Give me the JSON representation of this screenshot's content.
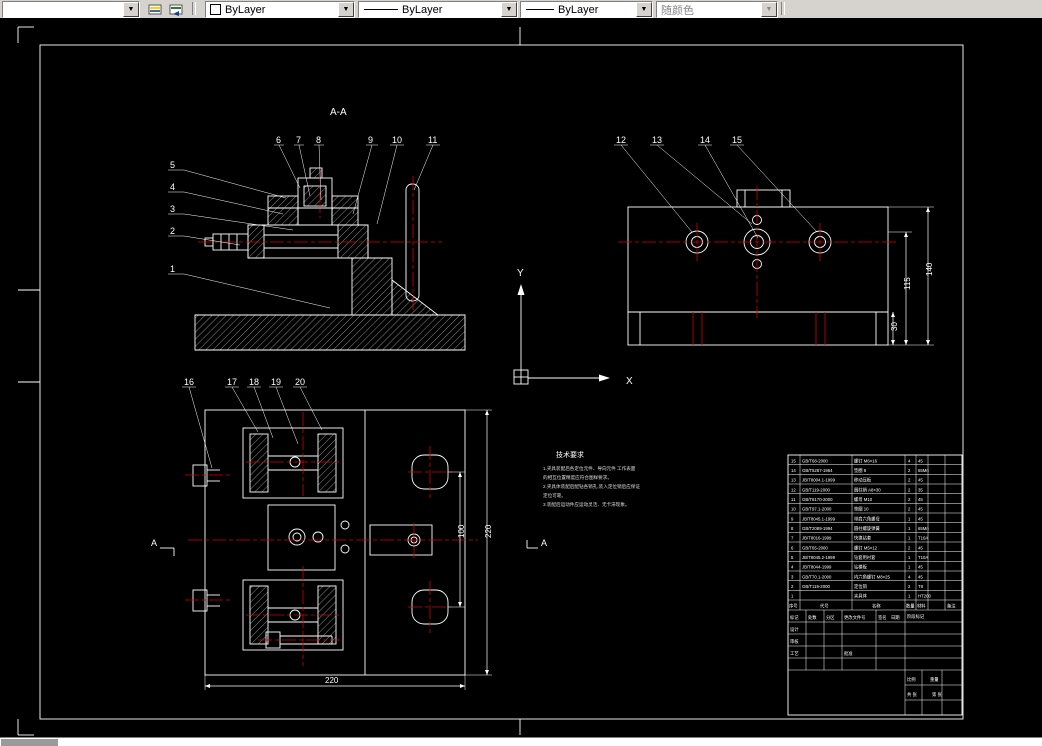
{
  "toolbar": {
    "color_combo": "ByLayer",
    "linetype_combo": "ByLayer",
    "lineweight_combo": "ByLayer",
    "plotstyle_combo": "随颜色"
  },
  "drawing": {
    "section_title": "A-A",
    "axis_x": "X",
    "axis_y": "Y",
    "section_mark_left": "A",
    "section_mark_right": "A",
    "callouts": {
      "c1": "1",
      "c2": "2",
      "c3": "3",
      "c4": "4",
      "c5": "5",
      "c6": "6",
      "c7": "7",
      "c8": "8",
      "c9": "9",
      "c10": "10",
      "c11": "11",
      "c12": "12",
      "c13": "13",
      "c14": "14",
      "c15": "15",
      "c16": "16",
      "c17": "17",
      "c18": "18",
      "c19": "19",
      "c20": "20"
    },
    "dimensions": {
      "d115": "115",
      "d140": "140",
      "d30": "30",
      "d100": "100",
      "d220v": "220",
      "d220h": "220"
    },
    "notes_title": "技术要求",
    "notes": [
      "1.夹具装配后各定位元件、导向元件 工作表面",
      "  的相互位置精度应符合图样要求。",
      "2.夹具体装配后配钻各销孔,装入定位销后应保证",
      "  定位可靠。",
      "3.装配后运动件应运动灵活、无卡滞现象。"
    ],
    "parts_list": {
      "rows": [
        {
          "no": "15",
          "code": "GB/T68-2000",
          "name": "螺钉 M6×16",
          "qty": "4",
          "mat": "45"
        },
        {
          "no": "14",
          "code": "GB/T5287-1964",
          "name": "垫圈 8",
          "qty": "2",
          "mat": "65Mn"
        },
        {
          "no": "13",
          "code": "JB/T8004.1-1999",
          "name": "移动压板",
          "qty": "2",
          "mat": "45"
        },
        {
          "no": "12",
          "code": "GB/T119-2000",
          "name": "圆柱销 A8×30",
          "qty": "2",
          "mat": "35"
        },
        {
          "no": "11",
          "code": "GB/T6170-2000",
          "name": "螺母 M10",
          "qty": "2",
          "mat": "45"
        },
        {
          "no": "10",
          "code": "GB/T97.1-2000",
          "name": "垫圈 10",
          "qty": "2",
          "mat": "45"
        },
        {
          "no": "9",
          "code": "JB/T8045.1-1999",
          "name": "带肩六角螺母",
          "qty": "1",
          "mat": "45"
        },
        {
          "no": "8",
          "code": "GB/T2089-1994",
          "name": "圆柱螺旋弹簧",
          "qty": "1",
          "mat": "65Mn"
        },
        {
          "no": "7",
          "code": "JB/T8016-1999",
          "name": "快换钻套",
          "qty": "1",
          "mat": "T10A"
        },
        {
          "no": "6",
          "code": "GB/T65-2000",
          "name": "螺钉 M5×12",
          "qty": "2",
          "mat": "45"
        },
        {
          "no": "5",
          "code": "JB/T8045.2-1999",
          "name": "钻套用衬套",
          "qty": "1",
          "mat": "T10A"
        },
        {
          "no": "4",
          "code": "JB/T8044-1999",
          "name": "钻模板",
          "qty": "1",
          "mat": "45"
        },
        {
          "no": "3",
          "code": "GB/T70.1-2000",
          "name": "内六角螺钉 M8×25",
          "qty": "4",
          "mat": "45"
        },
        {
          "no": "2",
          "code": "GB/T119-2000",
          "name": "定位销",
          "qty": "2",
          "mat": "T8"
        },
        {
          "no": "1",
          "code": "",
          "name": "夹具体",
          "qty": "1",
          "mat": "HT200"
        }
      ],
      "header": {
        "no": "序号",
        "code": "代号",
        "name": "名称",
        "qty": "数量",
        "mat": "材料",
        "note": "备注"
      }
    },
    "titleblock": {
      "mark": "标记",
      "count": "处数",
      "zone": "分区",
      "doc": "更改文件号",
      "sign": "签名",
      "date": "日期",
      "design": "设计",
      "check": "审核",
      "process": "工艺",
      "approve": "批准",
      "stage": "阶段标记",
      "weight": "重量",
      "scale": "比例",
      "sheets": "共 张",
      "sheet": "第 张"
    }
  }
}
